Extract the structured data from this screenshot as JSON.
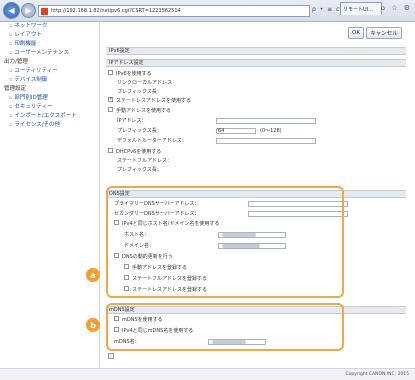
{
  "browser": {
    "url": "http://192.168.1.82/netipv6.cgi?CSRT=1223562514",
    "tab_title": "リモートUI...",
    "addr_icons": "ρ • ≡ c ×",
    "win_icons": "⌂ ☆ ⚙"
  },
  "sidebar": {
    "items": [
      {
        "type": "item",
        "label": "ネットワーク"
      },
      {
        "type": "item",
        "label": "レイアウト"
      },
      {
        "type": "item",
        "label": "印刷機能"
      },
      {
        "type": "item",
        "label": "ユーザーメンテナンス"
      },
      {
        "type": "group",
        "label": "出力/管理"
      },
      {
        "type": "item",
        "label": "ユーティリティー"
      },
      {
        "type": "item",
        "label": "デバイス制御"
      },
      {
        "type": "group",
        "label": "管理設定"
      },
      {
        "type": "item",
        "label": "部門別ID管理"
      },
      {
        "type": "item",
        "label": "セキュリティー"
      },
      {
        "type": "item",
        "label": "インポート/エクスポート"
      },
      {
        "type": "item",
        "label": "ライセンス/その他"
      }
    ]
  },
  "toolbar": {
    "ok": "OK",
    "cancel": "キャンセル"
  },
  "page_title": "IPv6設定",
  "ipv6": {
    "header": "IPアドレス設定",
    "use_ipv6": "IPv6を使用する",
    "link_local": "リンクローカルアドレス",
    "prefix_len": "プレフィックス長：",
    "stateless": "ステートレスアドレスを使用する",
    "manual": "手動アドレスを使用する",
    "ip_address": "IPアドレス：",
    "prefix_len2": "プレフィックス長：",
    "prefix_value": "64",
    "prefix_range": "(0〜128)",
    "default_router": "デフォルトルーターアドレス：",
    "dhcp": "DHCPv6を使用する",
    "stateful": "ステートフルアドレス：",
    "prefix_len3": "プレフィックス長："
  },
  "dns": {
    "header": "DNS設定",
    "primary": "プライマリーDNSサーバーアドレス：",
    "secondary": "セカンダリーDNSサーバーアドレス：",
    "same_host": "IPv4と同じホスト名/ドメイン名を使用する",
    "host_name": "ホスト名：",
    "domain_name": "ドメイン名：",
    "dynamic_update": "DNSの動的更新を行う",
    "register_manual": "手動アドレスを登録する",
    "register_stateful": "ステートフルアドレスを登録する",
    "register_stateless": "ステートレスアドレスを登録する"
  },
  "mdns": {
    "header": "mDNS設定",
    "use_mdns": "mDNSを使用する",
    "same_name": "IPv4と同じmDNS名を使用する",
    "mdns_name": "mDNS名："
  },
  "callouts": {
    "a": "a",
    "b": "b"
  },
  "footer": {
    "copyright": "Copyright CANON INC. 2015"
  },
  "colors": {
    "callout": "#f0a030",
    "link": "#1a4c9b"
  }
}
